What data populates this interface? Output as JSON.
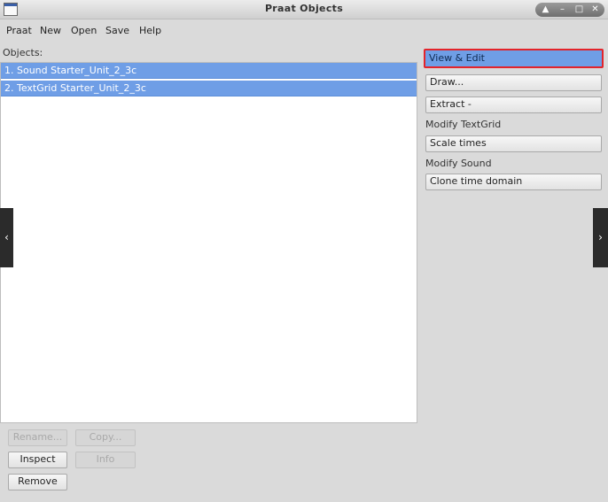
{
  "window": {
    "title": "Praat Objects",
    "controls": {
      "up": "▲",
      "minimize": "–",
      "maximize": "□",
      "close": "✕"
    }
  },
  "menu": [
    "Praat",
    "New",
    "Open",
    "Save",
    "Help"
  ],
  "objects_label": "Objects:",
  "objects": [
    "1. Sound Starter_Unit_2_3c",
    "2. TextGrid Starter_Unit_2_3c"
  ],
  "right_panel": {
    "view_edit": "View & Edit",
    "draw": "Draw...",
    "extract": "Extract -",
    "modify_textgrid_label": "Modify TextGrid",
    "scale_times": "Scale times",
    "modify_sound_label": "Modify Sound",
    "clone_time_domain": "Clone time domain"
  },
  "bottom_buttons": {
    "rename": "Rename...",
    "copy": "Copy...",
    "inspect": "Inspect",
    "info": "Info",
    "remove": "Remove"
  },
  "nav": {
    "prev": "‹",
    "next": "›"
  }
}
